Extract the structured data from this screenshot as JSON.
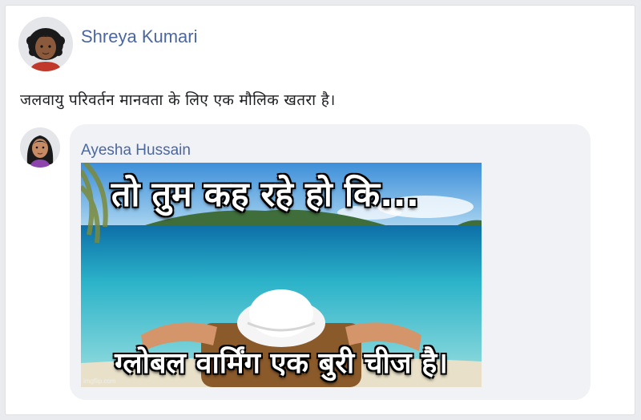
{
  "post": {
    "author": "Shreya Kumari",
    "text": "जलवायु परिवर्तन मानवता के लिए एक मौलिक खतरा है।",
    "avatar_icon": "woman-curly-hair-avatar-icon"
  },
  "comment": {
    "author": "Ayesha Hussain",
    "avatar_icon": "woman-long-hair-avatar-icon",
    "meme": {
      "top_text": "तो तुम कह रहे हो कि...",
      "bottom_text": "ग्लोबल वार्मिंग एक बुरी चीज है।",
      "watermark": "imgflip.com"
    }
  },
  "colors": {
    "author_link": "#4b67a1",
    "bubble": "#f0f2f5"
  }
}
